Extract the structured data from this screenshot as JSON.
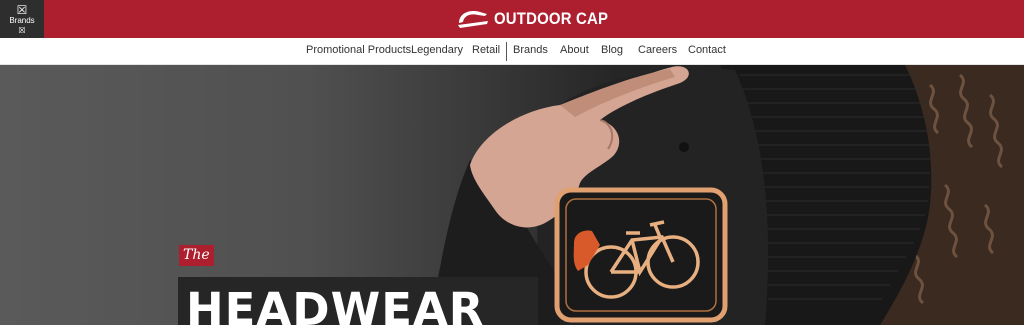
{
  "topbar": {
    "brands_tab": {
      "label": "Brands",
      "icon": "broken-image-icon",
      "icon_glyph": "☒",
      "small_icon_glyph": "☒"
    },
    "logo": {
      "icon": "outdoor-cap-logo-icon",
      "wordmark": "OUTDOOR CAP"
    },
    "colors": {
      "bar": "#ad1f2e",
      "tab": "#2e2e2e"
    }
  },
  "nav": {
    "items": [
      {
        "label": "Promotional Products"
      },
      {
        "label": "Legendary"
      },
      {
        "label": "Retail"
      },
      {
        "label": "Brands"
      },
      {
        "label": "About"
      },
      {
        "label": "Blog"
      },
      {
        "label": "Careers"
      },
      {
        "label": "Contact"
      }
    ]
  },
  "hero": {
    "badge": "The",
    "headline": "HEADWEAR",
    "image": "hand-holding-black-trucker-cap-with-bicycle-patch",
    "colors": {
      "badge": "#ad1f2e",
      "patch_stitch": "#e0a070"
    }
  }
}
